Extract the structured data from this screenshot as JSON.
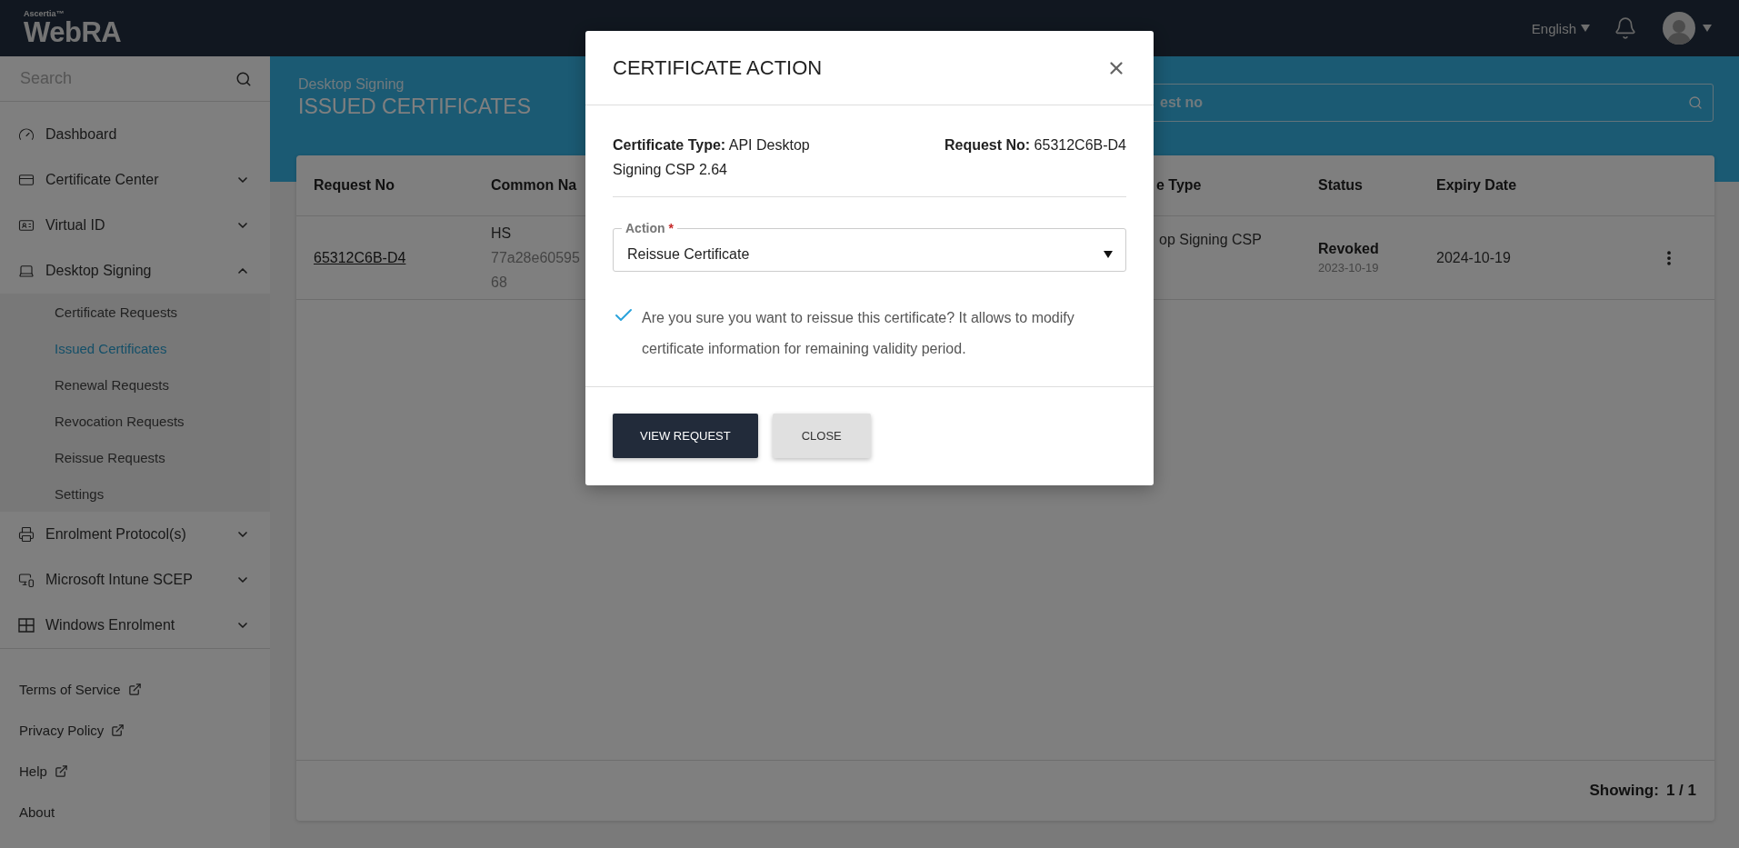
{
  "header": {
    "brand_small": "Ascertia™",
    "brand": "WebRA",
    "language": "English"
  },
  "sidebar": {
    "search": {
      "placeholder": "Search"
    },
    "items": [
      {
        "label": "Dashboard",
        "kind": "link"
      },
      {
        "label": "Certificate Center",
        "kind": "group",
        "expanded": false
      },
      {
        "label": "Virtual ID",
        "kind": "group",
        "expanded": false
      },
      {
        "label": "Desktop Signing",
        "kind": "group",
        "expanded": true,
        "children": [
          {
            "label": "Certificate Requests",
            "selected": false
          },
          {
            "label": "Issued Certificates",
            "selected": true
          },
          {
            "label": "Renewal Requests",
            "selected": false
          },
          {
            "label": "Revocation Requests",
            "selected": false
          },
          {
            "label": "Reissue Requests",
            "selected": false
          },
          {
            "label": "Settings",
            "selected": false
          }
        ]
      },
      {
        "label": "Enrolment Protocol(s)",
        "kind": "group",
        "expanded": false
      },
      {
        "label": "Microsoft Intune SCEP",
        "kind": "group",
        "expanded": false
      },
      {
        "label": "Windows Enrolment",
        "kind": "group",
        "expanded": false
      }
    ],
    "footer_links": [
      {
        "label": "Terms of Service",
        "external": true
      },
      {
        "label": "Privacy Policy",
        "external": true
      },
      {
        "label": "Help",
        "external": true
      },
      {
        "label": "About",
        "external": false
      }
    ]
  },
  "page": {
    "breadcrumb": "Desktop Signing",
    "title": "ISSUED CERTIFICATES",
    "search": {
      "placeholder": "est no"
    }
  },
  "table": {
    "columns": [
      "Request No",
      "Common Na",
      "e Type",
      "Status",
      "Expiry Date"
    ],
    "rows": [
      {
        "request_no": "65312C6B-D4",
        "common_name": "HS",
        "common_name_detail": [
          "77a28e60595",
          "68"
        ],
        "type": "op Signing CSP",
        "status": "Revoked",
        "status_date": "2023-10-19",
        "expiry_date": "2024-10-19"
      }
    ],
    "showing_label": "Showing:",
    "showing_value": "1 / 1"
  },
  "modal": {
    "title": "CERTIFICATE ACTION",
    "certificate_type": "**Certificate Type:** API Desktop Signing CSP 2.64",
    "request_no": "**Request No:** 65312C6B-D4",
    "action": {
      "label": "Action",
      "required_mark": "*",
      "value": "Reissue Certificate"
    },
    "confirm": {
      "checked": true,
      "text": "Are you sure you want to reissue this certificate? It allows to modify certificate information for remaining validity period."
    },
    "buttons": [
      {
        "label": "VIEW REQUEST",
        "kind": "primary"
      },
      {
        "label": "CLOSE",
        "kind": "secondary"
      }
    ]
  }
}
